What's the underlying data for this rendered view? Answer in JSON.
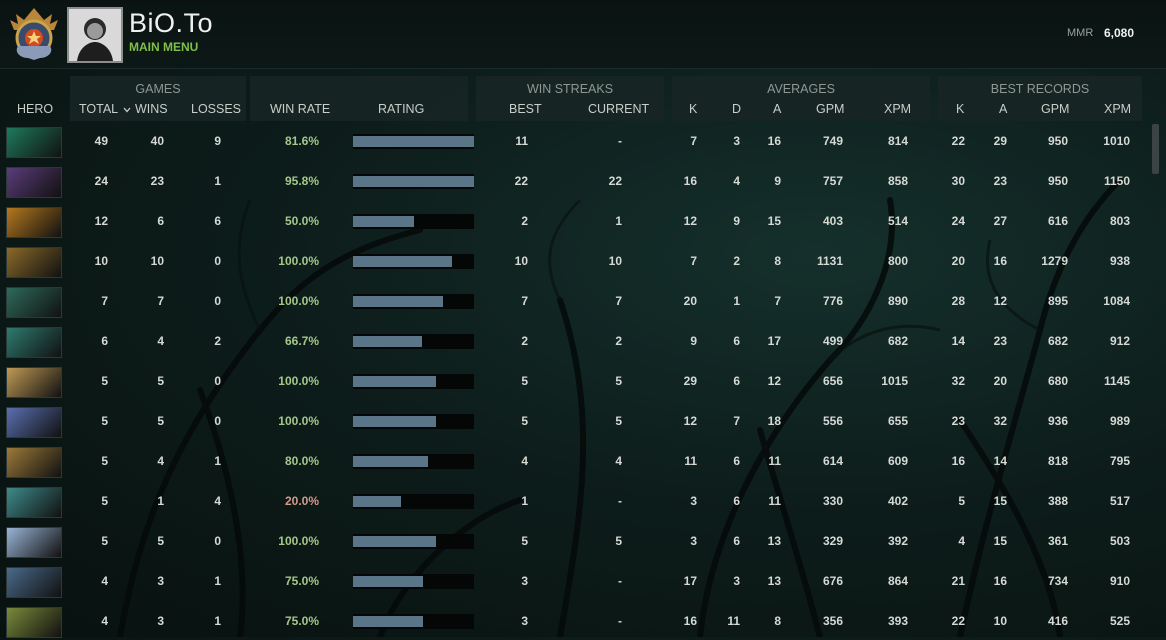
{
  "header": {
    "player_name": "BiO.To",
    "main_menu_label": "MAIN MENU",
    "mmr_label": "MMR",
    "mmr_value": "6,080"
  },
  "groups": {
    "games": "GAMES",
    "win_streaks": "WIN STREAKS",
    "averages": "AVERAGES",
    "best_records": "BEST RECORDS"
  },
  "columns": {
    "hero": "HERO",
    "total": "TOTAL",
    "wins": "WINS",
    "losses": "LOSSES",
    "win_rate": "WIN RATE",
    "rating": "RATING",
    "best": "BEST",
    "current": "CURRENT",
    "k": "K",
    "d": "D",
    "a": "A",
    "gpm": "GPM",
    "xpm": "XPM",
    "best_k": "K",
    "best_a": "A",
    "best_gpm": "GPM",
    "best_xpm": "XPM"
  },
  "sort_indicator_icon": "chevron-down-icon",
  "colors": {
    "win_rate_good": "#a5c78a",
    "win_rate_bad": "#d49a8a",
    "rating_bar": "#5b7588",
    "accent_green": "#7fbf4a"
  },
  "rows": [
    {
      "total": "49",
      "wins": "40",
      "losses": "9",
      "win_rate": "81.6%",
      "rating": 1.0,
      "best_streak": "11",
      "current_streak": "-",
      "k": "7",
      "d": "3",
      "a": "16",
      "gpm": "749",
      "xpm": "814",
      "best_k": "22",
      "best_a": "29",
      "best_gpm": "950",
      "best_xpm": "1010",
      "hero_color": "#1f7a5c"
    },
    {
      "total": "24",
      "wins": "23",
      "losses": "1",
      "win_rate": "95.8%",
      "rating": 1.0,
      "best_streak": "22",
      "current_streak": "22",
      "k": "16",
      "d": "4",
      "a": "9",
      "gpm": "757",
      "xpm": "858",
      "best_k": "30",
      "best_a": "23",
      "best_gpm": "950",
      "best_xpm": "1150",
      "hero_color": "#5b3c7a"
    },
    {
      "total": "12",
      "wins": "6",
      "losses": "6",
      "win_rate": "50.0%",
      "rating": 0.5,
      "best_streak": "2",
      "current_streak": "1",
      "k": "12",
      "d": "9",
      "a": "15",
      "gpm": "403",
      "xpm": "514",
      "best_k": "24",
      "best_a": "27",
      "best_gpm": "616",
      "best_xpm": "803",
      "hero_color": "#b4781e"
    },
    {
      "total": "10",
      "wins": "10",
      "losses": "0",
      "win_rate": "100.0%",
      "rating": 0.82,
      "best_streak": "10",
      "current_streak": "10",
      "k": "7",
      "d": "2",
      "a": "8",
      "gpm": "1131",
      "xpm": "800",
      "best_k": "20",
      "best_a": "16",
      "best_gpm": "1279",
      "best_xpm": "938",
      "hero_color": "#8a6a2a"
    },
    {
      "total": "7",
      "wins": "7",
      "losses": "0",
      "win_rate": "100.0%",
      "rating": 0.74,
      "best_streak": "7",
      "current_streak": "7",
      "k": "20",
      "d": "1",
      "a": "7",
      "gpm": "776",
      "xpm": "890",
      "best_k": "28",
      "best_a": "12",
      "best_gpm": "895",
      "best_xpm": "1084",
      "hero_color": "#2e6a5a"
    },
    {
      "total": "6",
      "wins": "4",
      "losses": "2",
      "win_rate": "66.7%",
      "rating": 0.57,
      "best_streak": "2",
      "current_streak": "2",
      "k": "9",
      "d": "6",
      "a": "17",
      "gpm": "499",
      "xpm": "682",
      "best_k": "14",
      "best_a": "23",
      "best_gpm": "682",
      "best_xpm": "912",
      "hero_color": "#2f7a6f"
    },
    {
      "total": "5",
      "wins": "5",
      "losses": "0",
      "win_rate": "100.0%",
      "rating": 0.69,
      "best_streak": "5",
      "current_streak": "5",
      "k": "29",
      "d": "6",
      "a": "12",
      "gpm": "656",
      "xpm": "1015",
      "best_k": "32",
      "best_a": "20",
      "best_gpm": "680",
      "best_xpm": "1145",
      "hero_color": "#c09a55"
    },
    {
      "total": "5",
      "wins": "5",
      "losses": "0",
      "win_rate": "100.0%",
      "rating": 0.69,
      "best_streak": "5",
      "current_streak": "5",
      "k": "12",
      "d": "7",
      "a": "18",
      "gpm": "556",
      "xpm": "655",
      "best_k": "23",
      "best_a": "32",
      "best_gpm": "936",
      "best_xpm": "989",
      "hero_color": "#5a6fb0"
    },
    {
      "total": "5",
      "wins": "4",
      "losses": "1",
      "win_rate": "80.0%",
      "rating": 0.62,
      "best_streak": "4",
      "current_streak": "4",
      "k": "11",
      "d": "6",
      "a": "11",
      "gpm": "614",
      "xpm": "609",
      "best_k": "16",
      "best_a": "14",
      "best_gpm": "818",
      "best_xpm": "795",
      "hero_color": "#9c7a3a"
    },
    {
      "total": "5",
      "wins": "1",
      "losses": "4",
      "win_rate": "20.0%",
      "rating": 0.4,
      "best_streak": "1",
      "current_streak": "-",
      "k": "3",
      "d": "6",
      "a": "11",
      "gpm": "330",
      "xpm": "402",
      "best_k": "5",
      "best_a": "15",
      "best_gpm": "388",
      "best_xpm": "517",
      "hero_color": "#3f8a8a"
    },
    {
      "total": "5",
      "wins": "5",
      "losses": "0",
      "win_rate": "100.0%",
      "rating": 0.69,
      "best_streak": "5",
      "current_streak": "5",
      "k": "3",
      "d": "6",
      "a": "13",
      "gpm": "329",
      "xpm": "392",
      "best_k": "4",
      "best_a": "15",
      "best_gpm": "361",
      "best_xpm": "503",
      "hero_color": "#9ab4d6"
    },
    {
      "total": "4",
      "wins": "3",
      "losses": "1",
      "win_rate": "75.0%",
      "rating": 0.58,
      "best_streak": "3",
      "current_streak": "-",
      "k": "17",
      "d": "3",
      "a": "13",
      "gpm": "676",
      "xpm": "864",
      "best_k": "21",
      "best_a": "16",
      "best_gpm": "734",
      "best_xpm": "910",
      "hero_color": "#4a6a8a"
    },
    {
      "total": "4",
      "wins": "3",
      "losses": "1",
      "win_rate": "75.0%",
      "rating": 0.58,
      "best_streak": "3",
      "current_streak": "-",
      "k": "16",
      "d": "11",
      "a": "8",
      "gpm": "356",
      "xpm": "393",
      "best_k": "22",
      "best_a": "10",
      "best_gpm": "416",
      "best_xpm": "525",
      "hero_color": "#7a8a3a"
    }
  ]
}
